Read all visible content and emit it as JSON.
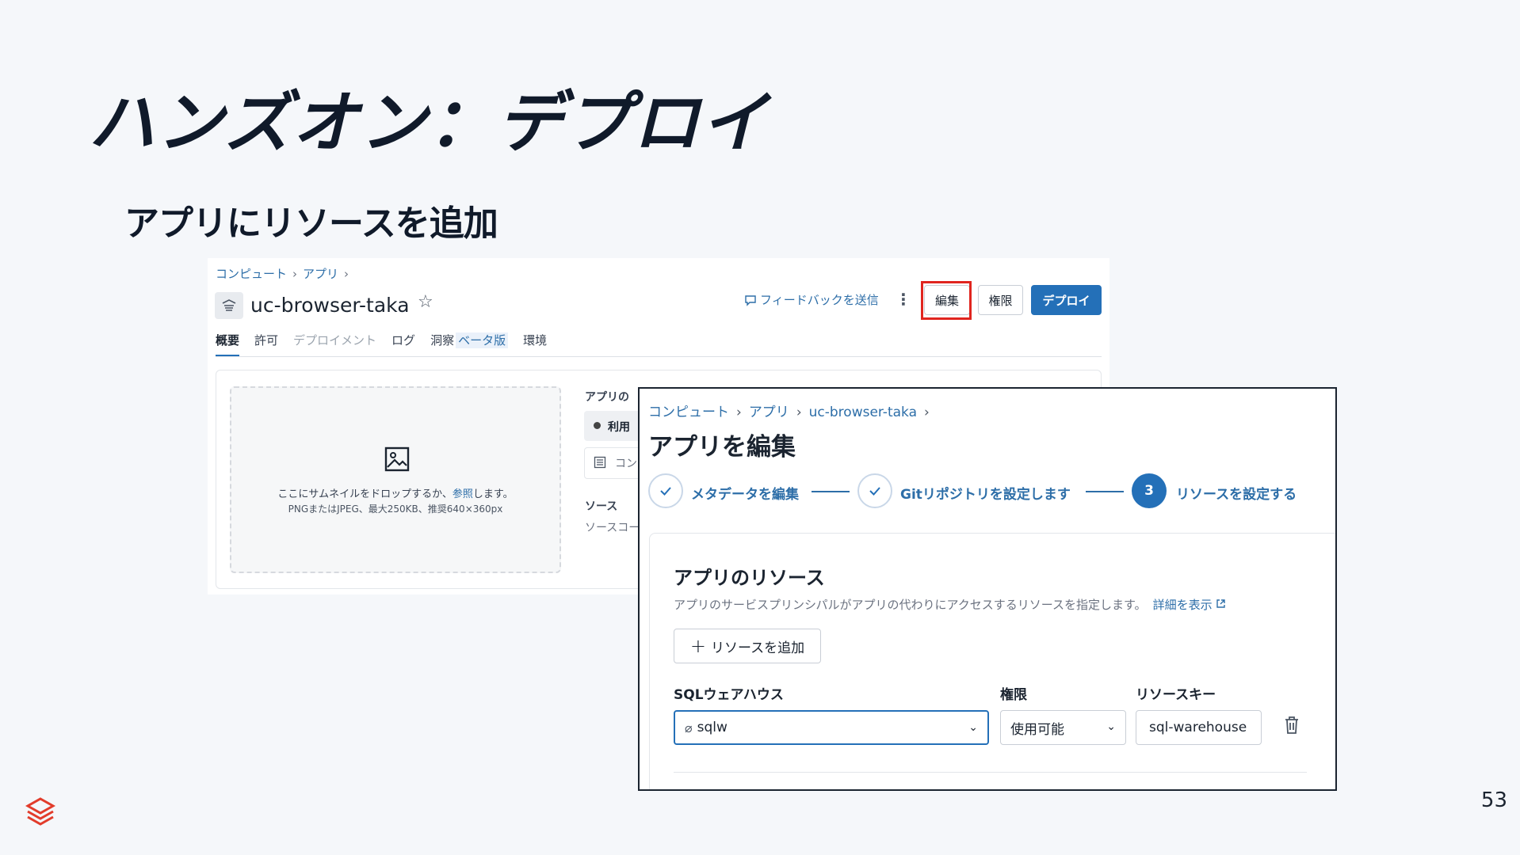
{
  "slide": {
    "title": "ハンズオン：デプロイ",
    "subtitle": "アプリにリソースを追加",
    "page_number": "53"
  },
  "app_page": {
    "breadcrumb": [
      "コンピュート",
      "アプリ"
    ],
    "app_name": "uc-browser-taka",
    "feedback_link": "フィードバックを送信",
    "buttons": {
      "edit": "編集",
      "permissions": "権限",
      "deploy": "デプロイ"
    },
    "tabs": [
      {
        "label": "概要"
      },
      {
        "label": "許可"
      },
      {
        "label": "デプロイメント"
      },
      {
        "label": "ログ"
      },
      {
        "label": "洞察"
      },
      {
        "label": "環境"
      }
    ],
    "beta_badge": "ベータ版",
    "thumbnail": {
      "text_before": "ここにサムネイルをドロップするか、",
      "link": "参照",
      "text_after": "します。",
      "hint": "PNGまたはJPEG、最大250KB、推奨640×360px"
    },
    "info_label": "アプリの",
    "status_text": "利用",
    "compute_text": "コン",
    "source_label": "ソース",
    "source_text": "ソースコー"
  },
  "edit_page": {
    "breadcrumb": [
      "コンピュート",
      "アプリ",
      "uc-browser-taka"
    ],
    "title": "アプリを編集",
    "steps": [
      {
        "label": "メタデータを編集",
        "state": "done"
      },
      {
        "label": "Gitリポジトリを設定します",
        "state": "done"
      },
      {
        "label": "リソースを設定する",
        "state": "current",
        "number": "3"
      }
    ],
    "resources": {
      "title": "アプリのリソース",
      "description": "アプリのサービスプリンシパルがアプリの代わりにアクセスするリソースを指定します。",
      "details_link": "詳細を表示",
      "add_button": "リソースを追加",
      "columns": {
        "resource": "SQLウェアハウス",
        "permission": "権限",
        "key": "リソースキー"
      },
      "row": {
        "resource": "sqlw",
        "permission": "使用可能",
        "key": "sql-warehouse"
      }
    }
  },
  "colors": {
    "accent": "#2470b8",
    "highlight": "#e0251f",
    "logo": "#e23c2b"
  }
}
